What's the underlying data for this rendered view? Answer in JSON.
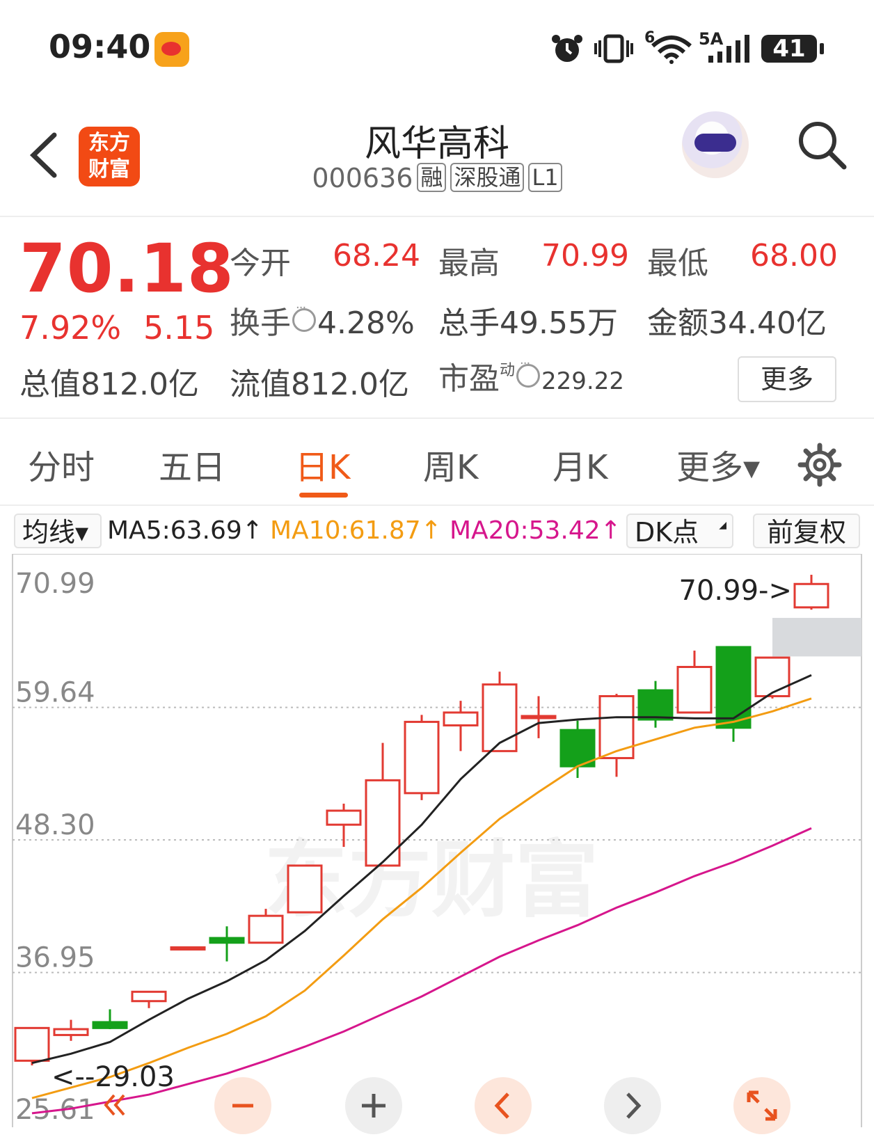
{
  "status_bar": {
    "time": "09:40",
    "battery": "41",
    "signal_label": "5A",
    "wifi_label": "6"
  },
  "header": {
    "logo_line1": "东方",
    "logo_line2": "财富",
    "stock_name": "风华高科",
    "stock_code": "000636",
    "tags": [
      "融",
      "深股通",
      "L1"
    ]
  },
  "quote": {
    "price": "70.18",
    "change_pct": "7.92%",
    "change_amt": "5.15",
    "open_label": "今开",
    "open": "68.24",
    "high_label": "最高",
    "high": "70.99",
    "low_label": "最低",
    "low": "68.00",
    "turnover_label": "换手",
    "turnover": "4.28%",
    "volume_text": "总手49.55万",
    "amount_text": "金额34.40亿",
    "total_cap_text": "总值812.0亿",
    "float_cap_text": "流值812.0亿",
    "pe_label": "市盈",
    "pe_sup": "动",
    "pe": "229.22",
    "more": "更多"
  },
  "tabs": [
    {
      "label": "分时"
    },
    {
      "label": "五日"
    },
    {
      "label": "日K"
    },
    {
      "label": "周K"
    },
    {
      "label": "月K"
    },
    {
      "label": "更多▾"
    }
  ],
  "indicator_bar": {
    "avg_line": "均线▾",
    "ma5": "MA5:63.69↑",
    "ma10": "MA10:61.87↑",
    "ma20": "MA20:53.42↑",
    "dk": "DK点",
    "adjust": "前复权"
  },
  "chart_data": {
    "type": "candlestick",
    "y_ticks": [
      "70.99",
      "59.64",
      "48.30",
      "36.95",
      "25.61"
    ],
    "ylim": [
      25.61,
      70.99
    ],
    "high_marker": "70.99->",
    "low_marker": "<--29.03",
    "watermark": "东方财富",
    "candles": [
      {
        "o": 29.4,
        "c": 32.2,
        "h": 32.2,
        "l": 29.0
      },
      {
        "o": 31.6,
        "c": 32.1,
        "h": 32.9,
        "l": 31.1
      },
      {
        "o": 32.7,
        "c": 32.2,
        "h": 33.8,
        "l": 32.1
      },
      {
        "o": 34.5,
        "c": 35.3,
        "h": 35.3,
        "l": 33.9
      },
      {
        "o": 39.1,
        "c": 39.1,
        "h": 39.1,
        "l": 39.1
      },
      {
        "o": 39.9,
        "c": 39.5,
        "h": 40.9,
        "l": 37.9
      },
      {
        "o": 39.5,
        "c": 41.8,
        "h": 42.4,
        "l": 39.5
      },
      {
        "o": 42.1,
        "c": 46.1,
        "h": 46.1,
        "l": 42.1
      },
      {
        "o": 49.6,
        "c": 50.8,
        "h": 51.4,
        "l": 47.7
      },
      {
        "o": 46.1,
        "c": 53.4,
        "h": 56.6,
        "l": 46.1
      },
      {
        "o": 52.3,
        "c": 58.4,
        "h": 59.0,
        "l": 51.7
      },
      {
        "o": 58.1,
        "c": 59.2,
        "h": 60.2,
        "l": 55.9
      },
      {
        "o": 55.9,
        "c": 61.6,
        "h": 62.7,
        "l": 55.9
      },
      {
        "o": 58.9,
        "c": 58.9,
        "h": 60.6,
        "l": 57.0
      },
      {
        "o": 57.7,
        "c": 54.6,
        "h": 58.5,
        "l": 53.6
      },
      {
        "o": 55.3,
        "c": 60.6,
        "h": 60.8,
        "l": 53.7
      },
      {
        "o": 61.1,
        "c": 58.6,
        "h": 61.9,
        "l": 57.9
      },
      {
        "o": 59.2,
        "c": 63.1,
        "h": 64.5,
        "l": 59.2
      },
      {
        "o": 64.8,
        "c": 57.9,
        "h": 64.8,
        "l": 56.7
      },
      {
        "o": 60.6,
        "c": 63.9,
        "h": 63.9,
        "l": 60.4
      },
      {
        "o": 68.2,
        "c": 70.2,
        "h": 70.99,
        "l": 68.0
      }
    ],
    "series": [
      {
        "name": "MA5",
        "color": "#222222",
        "values": [
          29.2,
          30.0,
          31.0,
          32.9,
          34.7,
          36.2,
          38.0,
          40.5,
          43.5,
          46.4,
          49.6,
          53.5,
          56.6,
          58.3,
          58.6,
          58.8,
          58.8,
          58.7,
          58.7,
          60.9,
          62.4
        ]
      },
      {
        "name": "MA10",
        "color": "#f39c12",
        "values": [
          26.2,
          27.1,
          28.0,
          29.2,
          30.5,
          31.7,
          33.2,
          35.4,
          38.4,
          41.5,
          44.2,
          47.2,
          50.1,
          52.4,
          54.6,
          55.9,
          56.9,
          57.9,
          58.4,
          59.3,
          60.4
        ]
      },
      {
        "name": "MA20",
        "color": "#d6168c",
        "values": [
          24.9,
          25.3,
          25.9,
          26.5,
          27.4,
          28.3,
          29.4,
          30.6,
          31.9,
          33.4,
          34.9,
          36.6,
          38.3,
          39.7,
          41.0,
          42.5,
          43.8,
          45.2,
          46.4,
          47.8,
          49.3
        ]
      }
    ],
    "colors": {
      "up": "#e23a32",
      "down": "#14a01a",
      "grid": "#bbbbbb"
    }
  }
}
